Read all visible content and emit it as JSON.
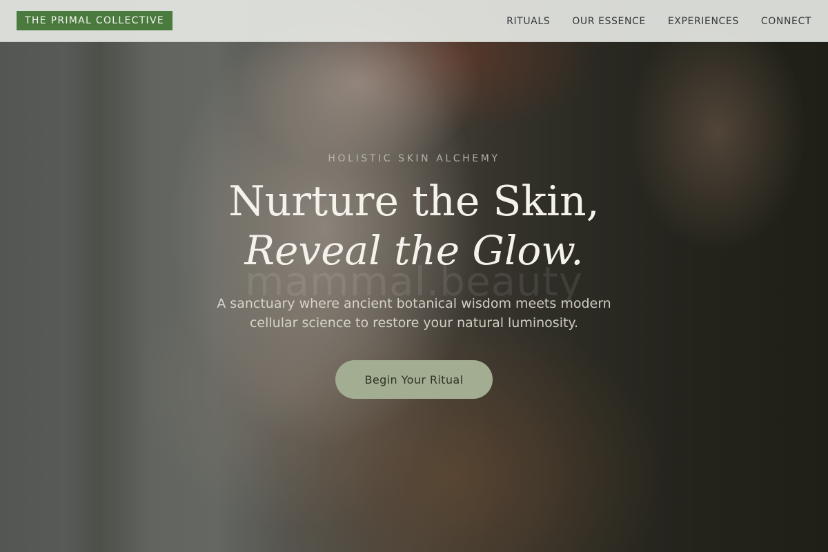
{
  "header": {
    "brand": "THE PRIMAL COLLECTIVE",
    "nav": [
      "RITUALS",
      "OUR ESSENCE",
      "EXPERIENCES",
      "CONNECT"
    ]
  },
  "hero": {
    "eyebrow": "HOLISTIC SKIN ALCHEMY",
    "headline_line1": "Nurture the Skin,",
    "headline_line2": "Reveal the Glow.",
    "watermark": "mammal.beauty",
    "subtext": "A sanctuary where ancient botanical wisdom meets modern cellular science to restore your natural luminosity.",
    "cta_label": "Begin Your Ritual"
  },
  "colors": {
    "brand_green": "#4b7a3f",
    "cta_sage": "#a3ad91",
    "header_bg": "#e4e6e2"
  }
}
